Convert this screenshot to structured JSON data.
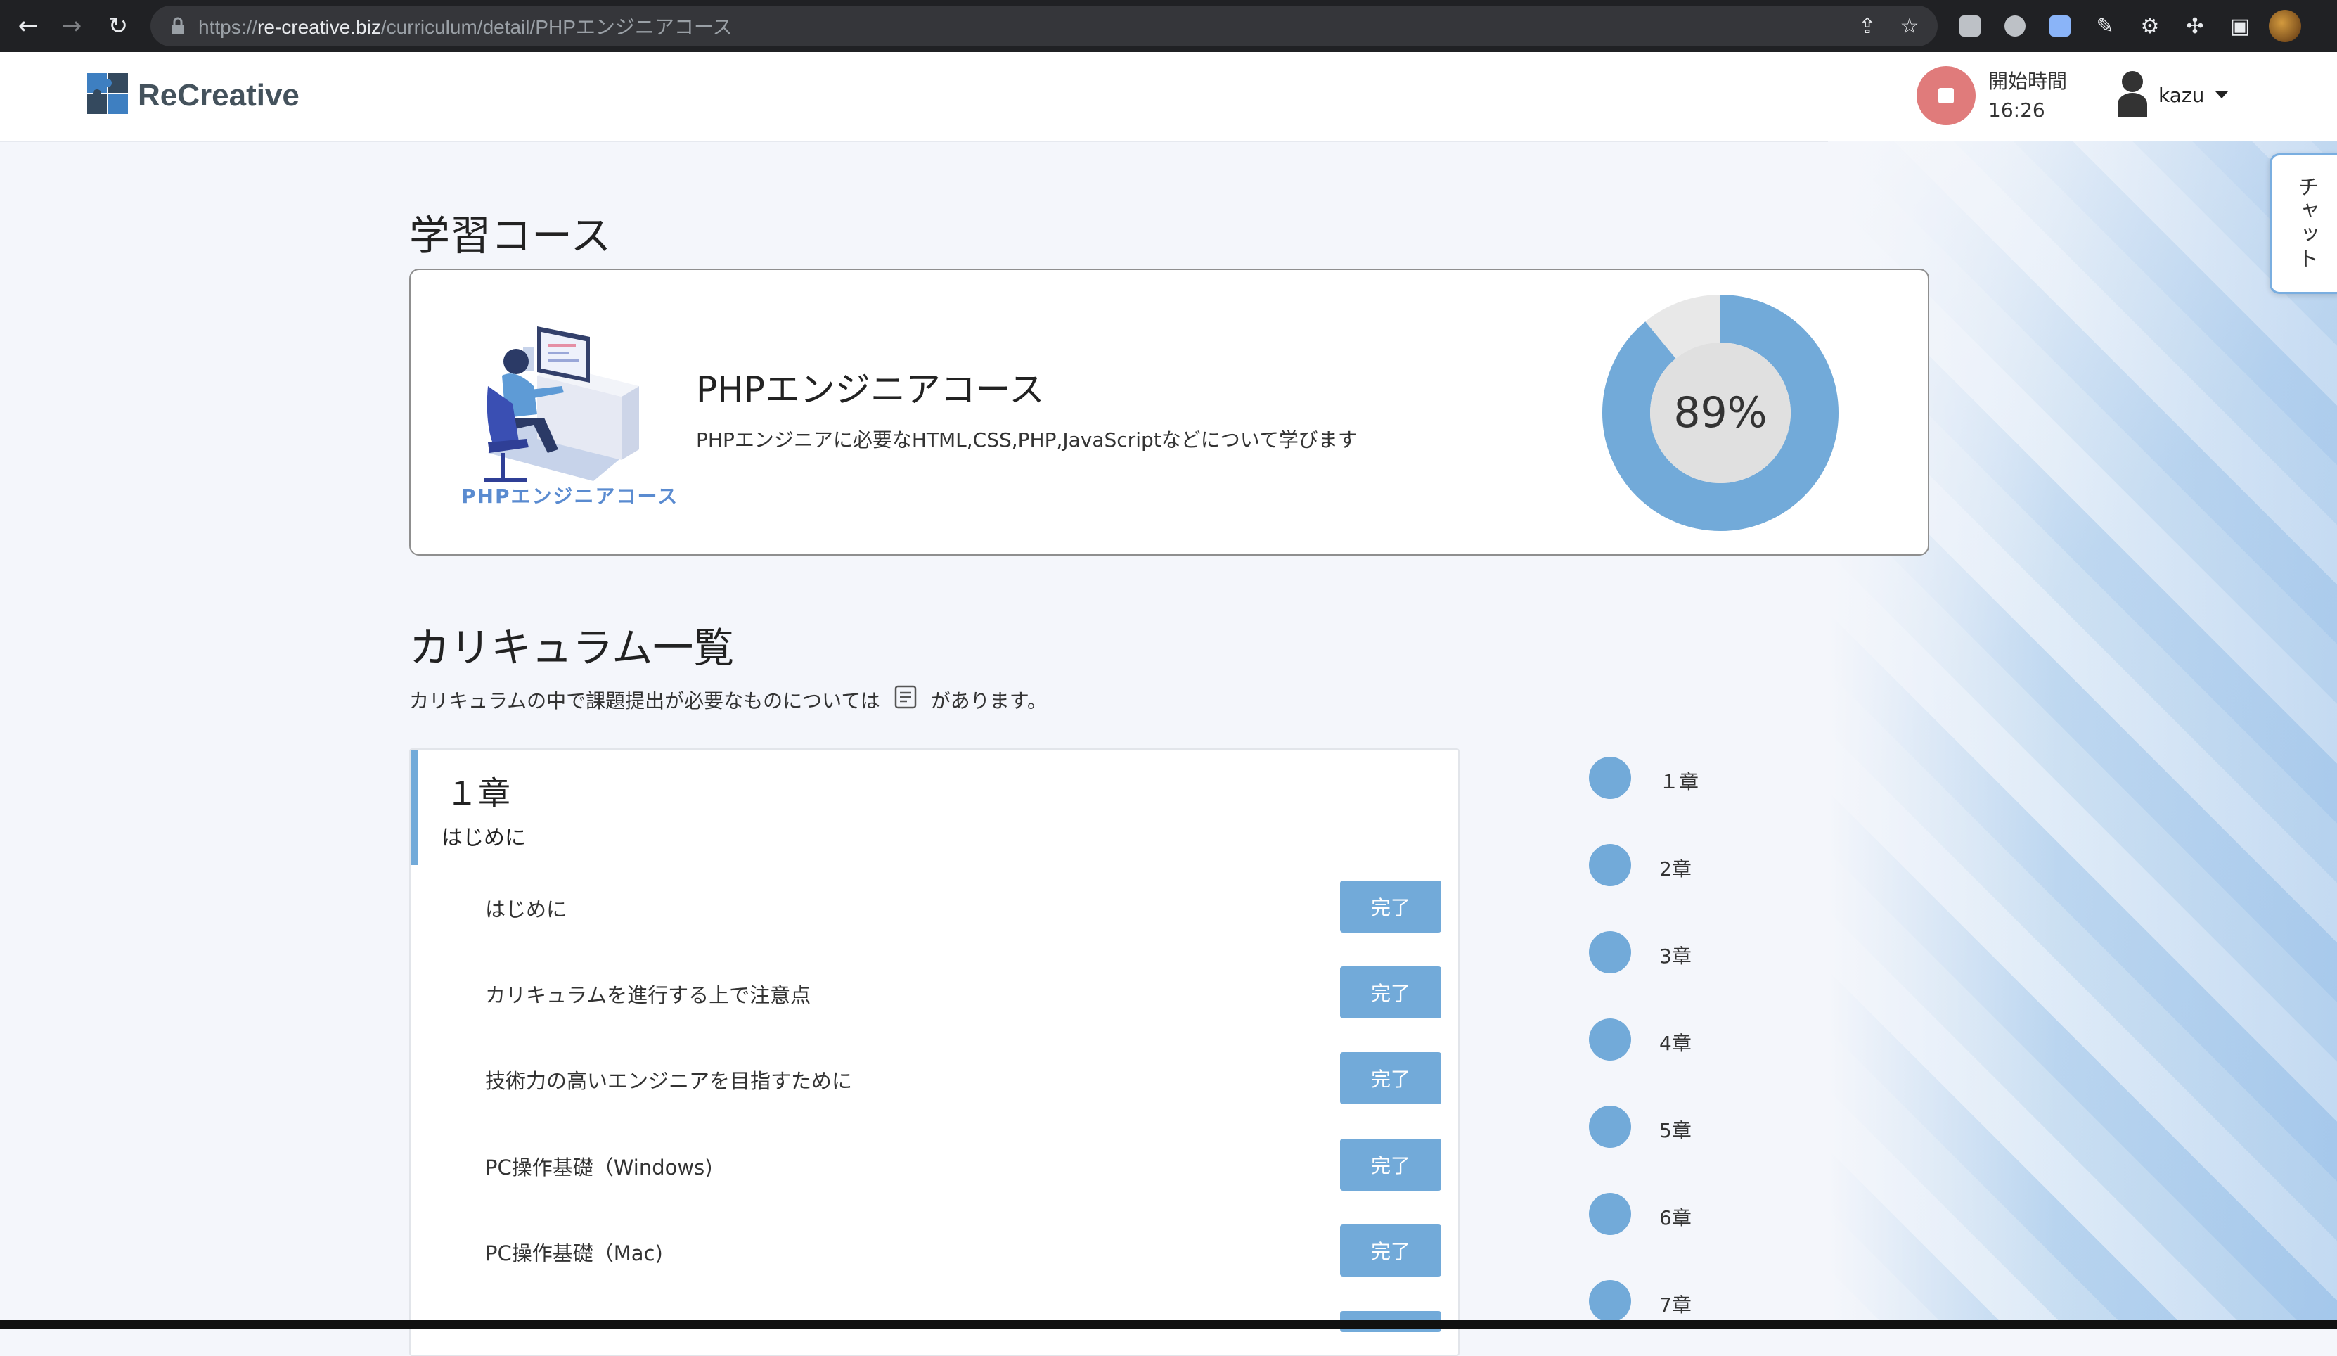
{
  "browser": {
    "url_prefix": "https://",
    "url_host": "re-creative.biz",
    "url_path": "/curriculum/detail/PHPエンジニアコース"
  },
  "header": {
    "logo_text": "ReCreative",
    "start_label": "開始時間",
    "start_time": "16:26",
    "username": "kazu"
  },
  "chat_tab": "チャット",
  "course_section": {
    "title": "学習コース",
    "illustration_label": "PHPエンジニアコース",
    "course_name": "PHPエンジニアコース",
    "description": "PHPエンジニアに必要なHTML,CSS,PHP,JavaScriptなどについて学びます",
    "progress_percent": 89,
    "progress_label": "89%"
  },
  "curriculum": {
    "title": "カリキュラム一覧",
    "note_before": "カリキュラムの中で課題提出が必要なものについては",
    "note_after": "があります。",
    "chapter": {
      "title": "１章",
      "subtitle": "はじめに",
      "lessons": [
        {
          "title": "はじめに",
          "status": "完了"
        },
        {
          "title": "カリキュラムを進行する上で注意点",
          "status": "完了"
        },
        {
          "title": "技術力の高いエンジニアを目指すために",
          "status": "完了"
        },
        {
          "title": "PC操作基礎（Windows)",
          "status": "完了"
        },
        {
          "title": "PC操作基礎（Mac)",
          "status": "完了"
        },
        {
          "title": "",
          "status": ""
        }
      ]
    },
    "chapter_nav": [
      "１章",
      "2章",
      "3章",
      "4章",
      "5章",
      "6章",
      "7章"
    ]
  },
  "colors": {
    "accent": "#72aad9",
    "donut_track": "#e8e8e8",
    "donut_center": "#e0e0e0",
    "stop_button": "#e07b7b"
  }
}
